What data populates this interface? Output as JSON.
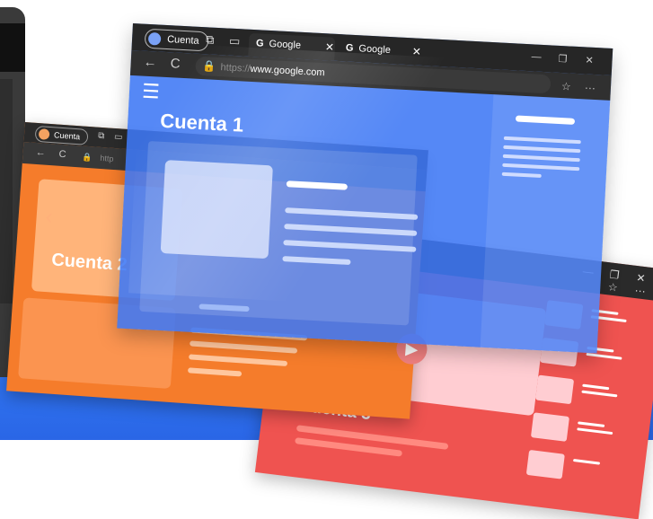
{
  "windows": {
    "back_left": {
      "profile_label": "Cuenta",
      "url_text": "http",
      "title": "Cuenta 2",
      "accent": "#f57c2b"
    },
    "back_right": {
      "title": "Cuenta 3",
      "accent": "#ef5350"
    },
    "front": {
      "profile_label": "Cuenta",
      "tabs": [
        {
          "label": "Google",
          "icon": "G"
        },
        {
          "label": "Google",
          "icon": "G"
        }
      ],
      "url_protocol": "https://",
      "url_host": "www.google.com",
      "title": "Cuenta 1",
      "accent": "#3e78f5"
    }
  },
  "icons": {
    "back": "←",
    "refresh": "C",
    "lock": "🔒",
    "minimize": "—",
    "restore": "❐",
    "close": "✕",
    "favorites": "☆",
    "more": "···",
    "menu": "☰",
    "play": "▶",
    "chevron_left": "‹"
  }
}
